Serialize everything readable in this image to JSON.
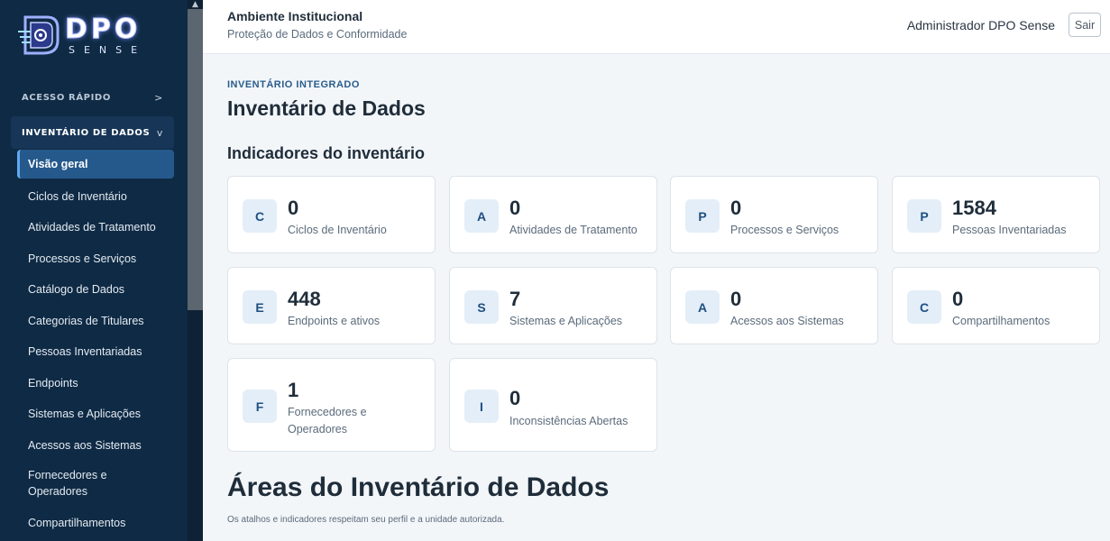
{
  "brand": {
    "line1": "DPO",
    "line2": "SENSE"
  },
  "sidebar": {
    "groups": [
      {
        "label": "ACESSO RÁPIDO",
        "chevron": ">"
      },
      {
        "label": "INVENTÁRIO DE DADOS",
        "chevron": "v"
      }
    ],
    "items": [
      {
        "label": "Visão geral",
        "active": true
      },
      {
        "label": "Ciclos de Inventário"
      },
      {
        "label": "Atividades de Tratamento"
      },
      {
        "label": "Processos e Serviços"
      },
      {
        "label": "Catálogo de Dados"
      },
      {
        "label": "Categorias de Titulares"
      },
      {
        "label": "Pessoas Inventariadas"
      },
      {
        "label": "Endpoints"
      },
      {
        "label": "Sistemas e Aplicações"
      },
      {
        "label": "Acessos aos Sistemas"
      },
      {
        "label": "Fornecedores e Operadores"
      },
      {
        "label": "Compartilhamentos"
      }
    ]
  },
  "topbar": {
    "title": "Ambiente Institucional",
    "subtitle": "Proteção de Dados e Conformidade",
    "user": "Administrador DPO Sense",
    "logout_label": "Sair"
  },
  "main": {
    "eyebrow": "INVENTÁRIO INTEGRADO",
    "title": "Inventário de Dados",
    "indicators_title": "Indicadores do inventário",
    "cards": [
      {
        "letter": "C",
        "value": "0",
        "label": "Ciclos de Inventário"
      },
      {
        "letter": "A",
        "value": "0",
        "label": "Atividades de Tratamento"
      },
      {
        "letter": "P",
        "value": "0",
        "label": "Processos e Serviços"
      },
      {
        "letter": "P",
        "value": "1584",
        "label": "Pessoas Inventariadas"
      },
      {
        "letter": "E",
        "value": "448",
        "label": "Endpoints e ativos"
      },
      {
        "letter": "S",
        "value": "7",
        "label": "Sistemas e Aplicações"
      },
      {
        "letter": "A",
        "value": "0",
        "label": "Acessos aos Sistemas"
      },
      {
        "letter": "C",
        "value": "0",
        "label": "Compartilhamentos"
      },
      {
        "letter": "F",
        "value": "1",
        "label": "Fornecedores e Operadores"
      },
      {
        "letter": "I",
        "value": "0",
        "label": "Inconsistências Abertas"
      }
    ],
    "areas_title": "Áreas do Inventário de Dados",
    "areas_subtitle": "Os atalhos e indicadores respeitam seu perfil e a unidade autorizada."
  },
  "colors": {
    "sidebar_bg": "#0f2a44",
    "active_item": "#25598c",
    "accent": "#2a5d8c",
    "badge_bg": "#e4eef8"
  }
}
